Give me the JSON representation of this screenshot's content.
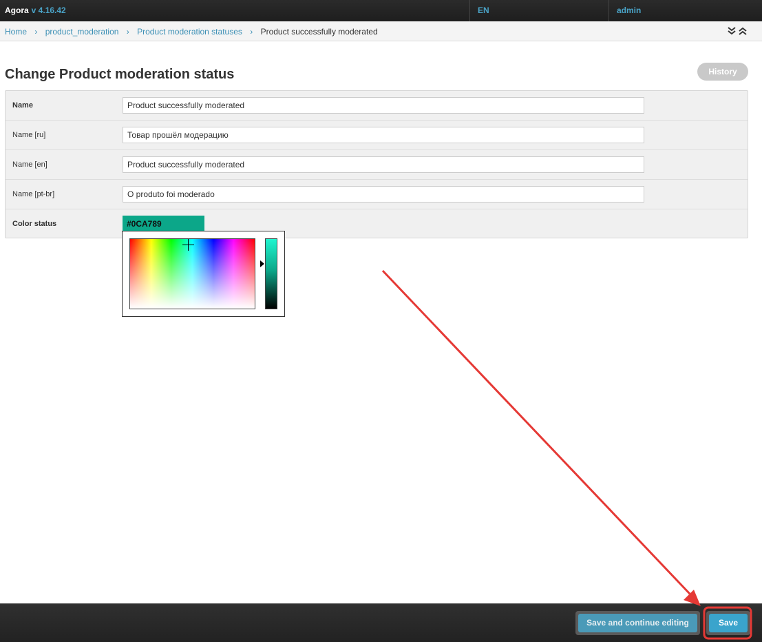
{
  "header": {
    "brand": "Agora",
    "version": "v 4.16.42",
    "language": "EN",
    "user": "admin"
  },
  "breadcrumbs": {
    "items": [
      "Home",
      "product_moderation",
      "Product moderation statuses"
    ],
    "current": "Product successfully moderated"
  },
  "page": {
    "title": "Change Product moderation status",
    "history_label": "History"
  },
  "form": {
    "fields": [
      {
        "label": "Name",
        "value": "Product successfully moderated"
      },
      {
        "label": "Name [ru]",
        "value": "Товар прошёл модерацию"
      },
      {
        "label": "Name [en]",
        "value": "Product successfully moderated"
      },
      {
        "label": "Name [pt-br]",
        "value": "O produto foi moderado"
      }
    ],
    "color_status": {
      "label": "Color status",
      "value": "#0CA789"
    }
  },
  "footer": {
    "save_continue_label": "Save and continue editing",
    "save_label": "Save"
  },
  "colors": {
    "accent": "#4aa3c7",
    "swatch": "#0CA789",
    "annotation": "#e53935"
  },
  "icons": {
    "breadcrumb_separator": "chevron-right-icon",
    "collapse_down": "double-chevron-down-icon",
    "collapse_up": "double-chevron-up-icon",
    "picker_crosshair": "crosshair-icon"
  }
}
